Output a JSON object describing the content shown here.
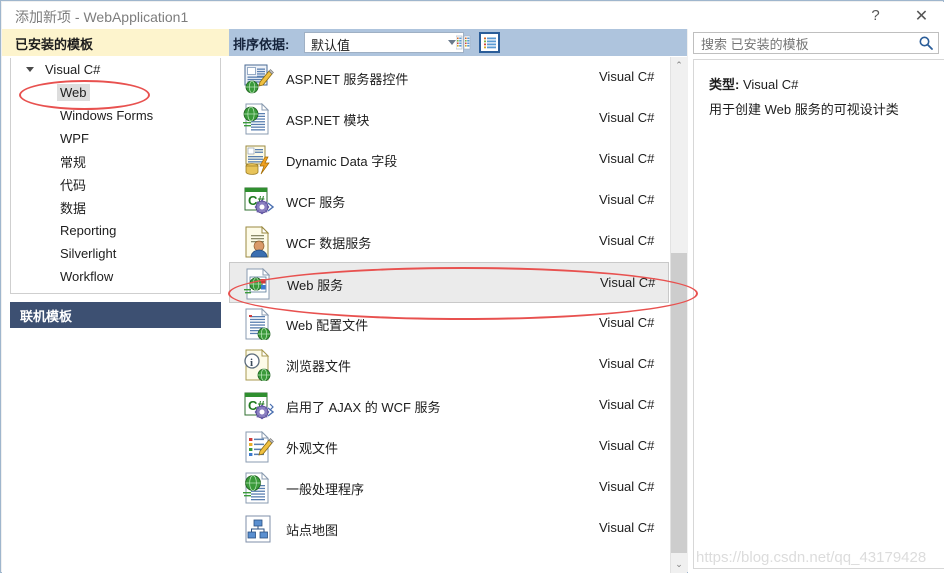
{
  "window": {
    "title": "添加新项 - WebApplication1",
    "help_button": "?",
    "close_button": "✕"
  },
  "left_panel": {
    "installed_header": "已安装的模板",
    "tree": {
      "root_label": "Visual C#",
      "children": [
        {
          "label": "Web",
          "selected": true
        },
        {
          "label": "Windows Forms",
          "selected": false
        },
        {
          "label": "WPF",
          "selected": false
        },
        {
          "label": "常规",
          "selected": false
        },
        {
          "label": "代码",
          "selected": false
        },
        {
          "label": "数据",
          "selected": false
        },
        {
          "label": "Reporting",
          "selected": false
        },
        {
          "label": "Silverlight",
          "selected": false
        },
        {
          "label": "Workflow",
          "selected": false
        }
      ]
    },
    "online_templates": "联机模板"
  },
  "toolbar": {
    "sort_label": "排序依据:",
    "sort_value": "默认值",
    "sort_options": [
      "默认值"
    ],
    "view_tiles_name": "tiles-view-icon",
    "view_list_name": "list-view-icon",
    "view_selected": "list"
  },
  "templates": {
    "language_default": "Visual C#",
    "items": [
      {
        "name": "ASP.NET 服务器控件",
        "language": "Visual C#",
        "icon": "aspnet-server-control-icon",
        "selected": false
      },
      {
        "name": "ASP.NET 模块",
        "language": "Visual C#",
        "icon": "aspnet-module-icon",
        "selected": false
      },
      {
        "name": "Dynamic Data 字段",
        "language": "Visual C#",
        "icon": "dynamic-data-field-icon",
        "selected": false
      },
      {
        "name": "WCF 服务",
        "language": "Visual C#",
        "icon": "wcf-service-icon",
        "selected": false
      },
      {
        "name": "WCF 数据服务",
        "language": "Visual C#",
        "icon": "wcf-data-service-icon",
        "selected": false
      },
      {
        "name": "Web 服务",
        "language": "Visual C#",
        "icon": "web-service-icon",
        "selected": true
      },
      {
        "name": "Web 配置文件",
        "language": "Visual C#",
        "icon": "web-config-file-icon",
        "selected": false
      },
      {
        "name": "浏览器文件",
        "language": "Visual C#",
        "icon": "browser-file-icon",
        "selected": false
      },
      {
        "name": "启用了 AJAX 的 WCF 服务",
        "language": "Visual C#",
        "icon": "ajax-wcf-service-icon",
        "selected": false
      },
      {
        "name": "外观文件",
        "language": "Visual C#",
        "icon": "skin-file-icon",
        "selected": false
      },
      {
        "name": "一般处理程序",
        "language": "Visual C#",
        "icon": "generic-handler-icon",
        "selected": false
      },
      {
        "name": "站点地图",
        "language": "Visual C#",
        "icon": "site-map-icon",
        "selected": false
      }
    ]
  },
  "search": {
    "value": "",
    "placeholder": "搜索 已安装的模板",
    "icon": "search-icon"
  },
  "details": {
    "type_label": "类型:",
    "type_value": "Visual C#",
    "description": "用于创建 Web 服务的可视设计类"
  },
  "scrollbar": {
    "up_arrow": "⌃",
    "down_arrow": "⌄"
  },
  "watermark": "https://blog.csdn.net/qq_43179428",
  "colors": {
    "installed_header_bg": "#fdf4cd",
    "online_templates_bg": "#3d5072",
    "sort_bar_bg": "#aec4dd",
    "selected_row_bg": "#ebebeb",
    "annotation_red": "#e8514f",
    "accent_blue": "#2a5d99"
  }
}
